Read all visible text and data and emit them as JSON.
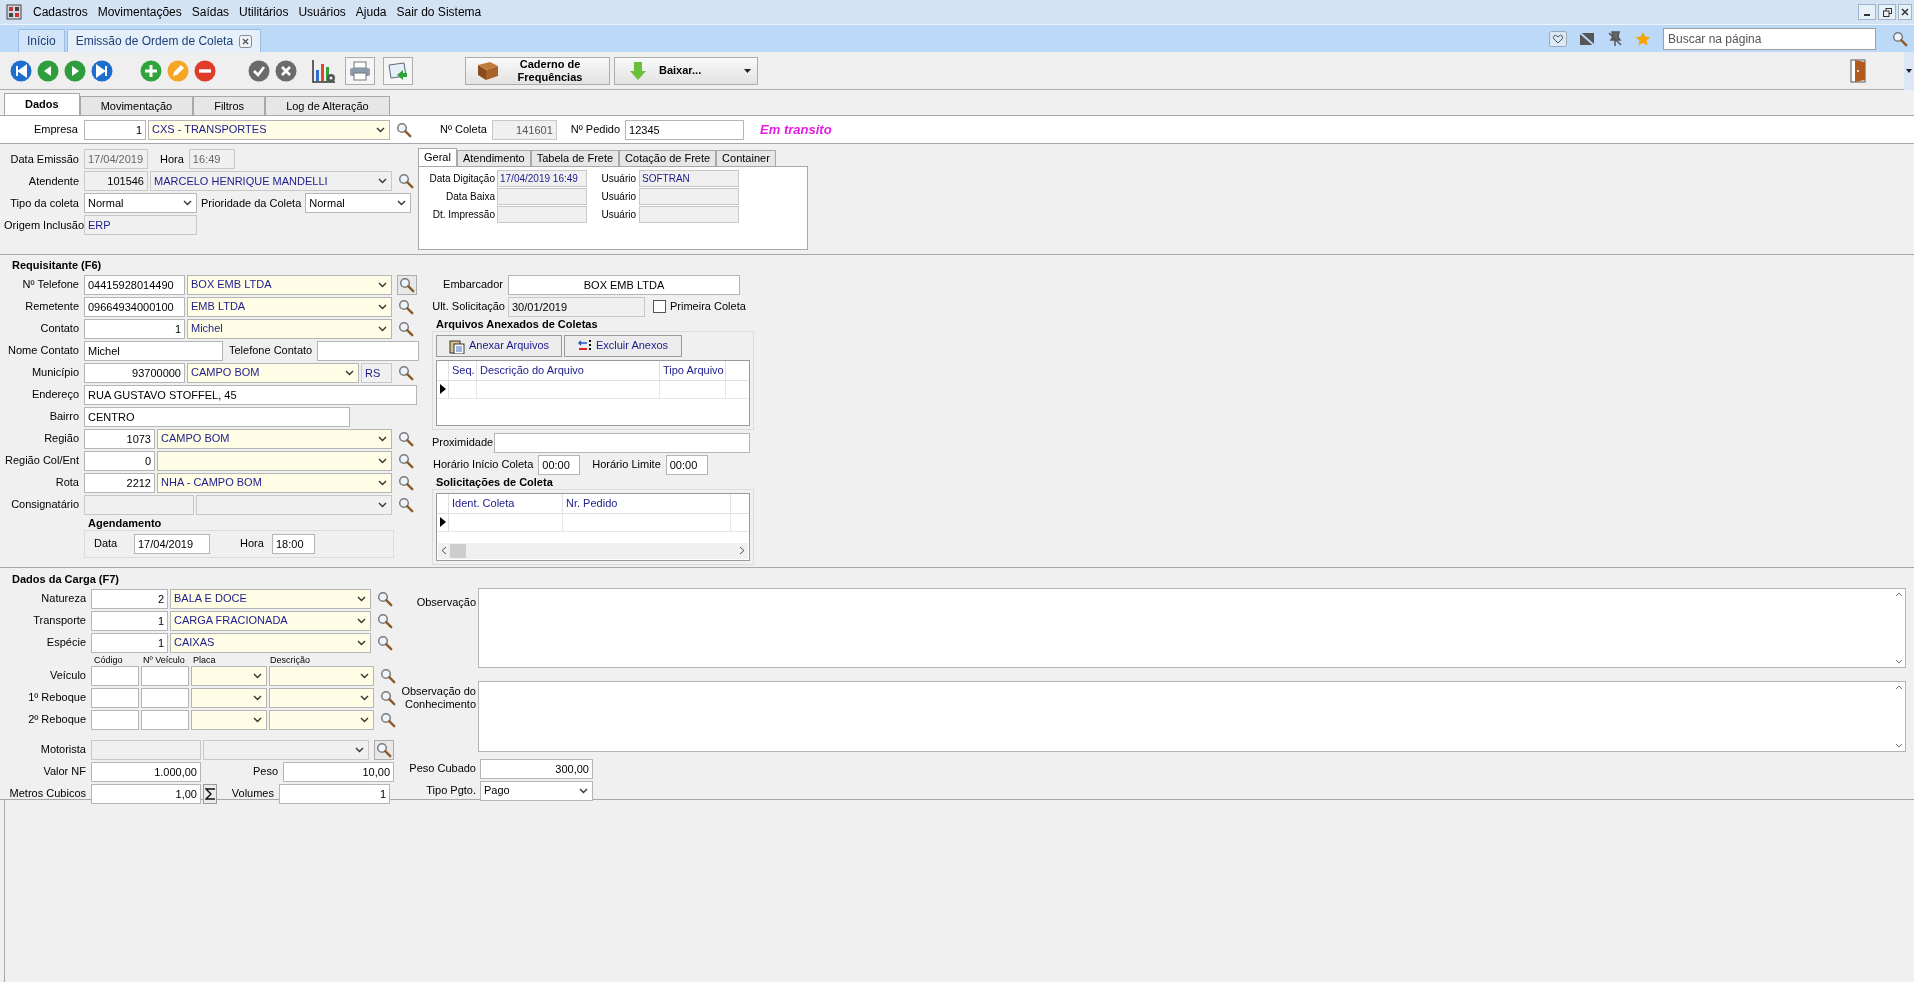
{
  "menu": [
    "Cadastros",
    "Movimentações",
    "Saídas",
    "Utilitários",
    "Usuários",
    "Ajuda",
    "Sair do Sistema"
  ],
  "doc_tabs": [
    {
      "label": "Início",
      "selected": false,
      "closable": false
    },
    {
      "label": "Emissão de Ordem de Coleta",
      "selected": true,
      "closable": true
    }
  ],
  "search": {
    "placeholder": "Buscar na página"
  },
  "toolbar_buttons": [
    {
      "label": "Caderno de Frequências"
    },
    {
      "label": "Baixar..."
    }
  ],
  "form_tabs": [
    {
      "label": "Dados",
      "selected": true
    },
    {
      "label": "Movimentação",
      "selected": false
    },
    {
      "label": "Filtros",
      "selected": false
    },
    {
      "label": "Log de Alteração",
      "selected": false
    }
  ],
  "header": {
    "empresa": {
      "label": "Empresa",
      "code": "1",
      "name": "CXS - TRANSPORTES"
    },
    "coleta": {
      "label": "Nº Coleta",
      "value": "141601"
    },
    "pedido": {
      "label": "Nº Pedido",
      "value": "12345"
    },
    "status": "Em transito"
  },
  "emissao": {
    "data": {
      "label": "Data Emissão",
      "value": "17/04/2019"
    },
    "hora": {
      "label": "Hora",
      "value": "16:49"
    },
    "atendente": {
      "label": "Atendente",
      "code": "101546",
      "name": "MARCELO HENRIQUE MANDELLI"
    },
    "tipo": {
      "label": "Tipo da coleta",
      "value": "Normal"
    },
    "prioridade": {
      "label": "Prioridade da Coleta",
      "value": "Normal"
    },
    "origem": {
      "label": "Origem Inclusão",
      "value": "ERP"
    }
  },
  "info_tabs": {
    "tabs": [
      {
        "label": "Geral",
        "selected": true
      },
      {
        "label": "Atendimento",
        "selected": false
      },
      {
        "label": "Tabela de Frete",
        "selected": false
      },
      {
        "label": "Cotação de Frete",
        "selected": false
      },
      {
        "label": "Container",
        "selected": false
      }
    ],
    "rows": [
      {
        "label": "Data Digitação",
        "value": "17/04/2019 16:49",
        "user_label": "Usuário",
        "user": "SOFTRAN"
      },
      {
        "label": "Data Baixa",
        "user_label": "Usuário"
      },
      {
        "label": "Dt. Impressão",
        "user_label": "Usuário"
      }
    ]
  },
  "requisitante": {
    "title": "Requisitante (F6)",
    "telefone": {
      "label": "Nº Telefone",
      "code": "04415928014490",
      "name": "BOX EMB LTDA"
    },
    "remetente": {
      "label": "Remetente",
      "code": "09664934000100",
      "name": "EMB LTDA"
    },
    "contato": {
      "label": "Contato",
      "code": "1",
      "name": "Michel"
    },
    "nome_contato": {
      "label": "Nome Contato",
      "value": "Michel"
    },
    "telefone_contato": {
      "label": "Telefone Contato"
    },
    "municipio": {
      "label": "Município",
      "code": "93700000",
      "name": "CAMPO BOM",
      "uf": "RS"
    },
    "endereco": {
      "label": "Endereço",
      "value": "RUA GUSTAVO STOFFEL, 45"
    },
    "bairro": {
      "label": "Bairro",
      "value": "CENTRO"
    },
    "regiao": {
      "label": "Região",
      "code": "1073",
      "name": "CAMPO BOM"
    },
    "regiao_col": {
      "label": "Região Col/Ent",
      "code": "0"
    },
    "rota": {
      "label": "Rota",
      "code": "2212",
      "name": "NHA - CAMPO BOM"
    },
    "consignatario": {
      "label": "Consignatário"
    },
    "agendamento": {
      "title": "Agendamento",
      "data_label": "Data",
      "data": "17/04/2019",
      "hora_label": "Hora",
      "hora": "18:00"
    },
    "embarcador": {
      "label": "Embarcador",
      "value": "BOX EMB LTDA"
    },
    "ult_solicitacao": {
      "label": "Ult. Solicitação",
      "value": "30/01/2019"
    },
    "primeira_coleta": {
      "label": "Primeira Coleta",
      "checked": false
    },
    "arquivos": {
      "title": "Arquivos Anexados de Coletas",
      "buttons": [
        "Anexar Arquivos",
        "Excluir Anexos"
      ],
      "columns": [
        "Seq.",
        "Descrição do Arquivo",
        "Tipo Arquivo"
      ]
    },
    "proximidade": {
      "label": "Proximidade"
    },
    "horario_inicio": {
      "label": "Horário Início Coleta",
      "value": "00:00"
    },
    "horario_limite": {
      "label": "Horário Limite",
      "value": "00:00"
    },
    "solicitacoes": {
      "title": "Solicitações de Coleta",
      "columns": [
        "Ident. Coleta",
        "Nr. Pedido"
      ]
    }
  },
  "carga": {
    "title": "Dados da Carga (F7)",
    "lookups": [
      {
        "label": "Natureza",
        "code": "2",
        "name": "BALA E DOCE"
      },
      {
        "label": "Transporte",
        "code": "1",
        "name": "CARGA FRACIONADA"
      },
      {
        "label": "Espécie",
        "code": "1",
        "name": "CAIXAS"
      }
    ],
    "vehicle_columns": [
      "Código",
      "Nº Veículo",
      "Placa",
      "Descrição"
    ],
    "vehicles": [
      "Veículo",
      "1º Reboque",
      "2º Reboque"
    ],
    "motorista": {
      "label": "Motorista"
    },
    "valor_nf": {
      "label": "Valor NF",
      "value": "1.000,00"
    },
    "peso": {
      "label": "Peso",
      "value": "10,00"
    },
    "metros": {
      "label": "Metros Cubicos",
      "value": "1,00"
    },
    "volumes": {
      "label": "Volumes",
      "value": "1"
    },
    "observacao": {
      "label": "Observação"
    },
    "obs_conhecimento": {
      "label": "Observação do Conhecimento"
    },
    "peso_cubado": {
      "label": "Peso Cubado",
      "value": "300,00"
    },
    "tipo_pgto": {
      "label": "Tipo Pgto.",
      "value": "Pago"
    }
  }
}
